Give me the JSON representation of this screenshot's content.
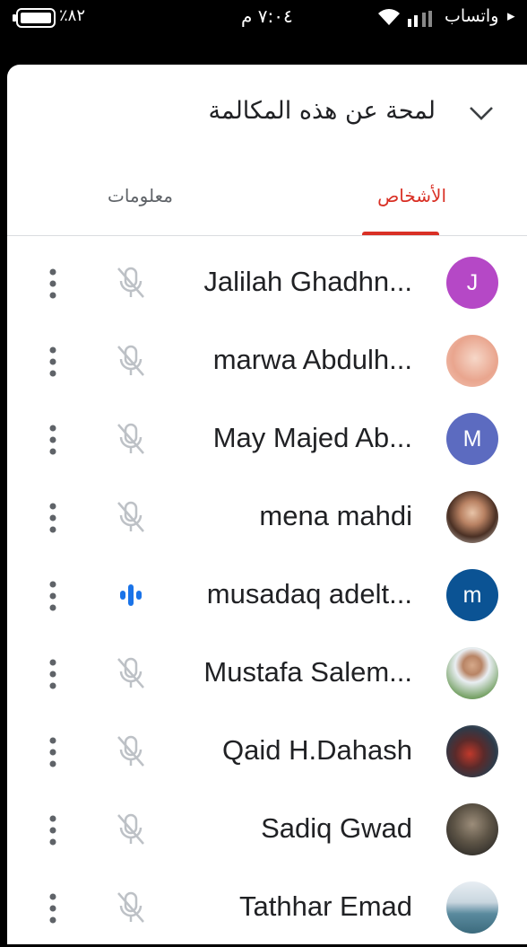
{
  "status_bar": {
    "back_arrow": "▸",
    "carrier": "واتساب",
    "time": "٧:٠٤ م",
    "battery_percent": "٪٨٢"
  },
  "header": {
    "title": "لمحة عن هذه المكالمة"
  },
  "tabs": [
    {
      "label": "الأشخاص",
      "active": true
    },
    {
      "label": "معلومات",
      "active": false
    }
  ],
  "colors": {
    "accent": "#d93025",
    "speaking": "#1a73e8"
  },
  "participants": [
    {
      "name": "Jalilah Ghadhn...",
      "avatar_letter": "J",
      "avatar_color": "#b548c6",
      "mic": "muted"
    },
    {
      "name": "marwa Abdulh...",
      "avatar_icon": "photo-avatar-icon",
      "mic": "muted"
    },
    {
      "name": "May Majed Ab...",
      "avatar_letter": "M",
      "avatar_color": "#5c6bc0",
      "mic": "muted"
    },
    {
      "name": "mena mahdi",
      "avatar_icon": "photo-avatar-icon",
      "mic": "muted"
    },
    {
      "name": "musadaq adelt...",
      "avatar_letter": "m",
      "avatar_color": "#0b5394",
      "mic": "speaking"
    },
    {
      "name": "Mustafa Salem...",
      "avatar_icon": "photo-avatar-icon",
      "mic": "muted"
    },
    {
      "name": "Qaid H.Dahash",
      "avatar_icon": "photo-avatar-icon",
      "mic": "muted"
    },
    {
      "name": "Sadiq Gwad",
      "avatar_icon": "photo-avatar-icon",
      "mic": "muted"
    },
    {
      "name": "Tathhar Emad",
      "avatar_icon": "photo-avatar-icon",
      "mic": "muted"
    }
  ]
}
